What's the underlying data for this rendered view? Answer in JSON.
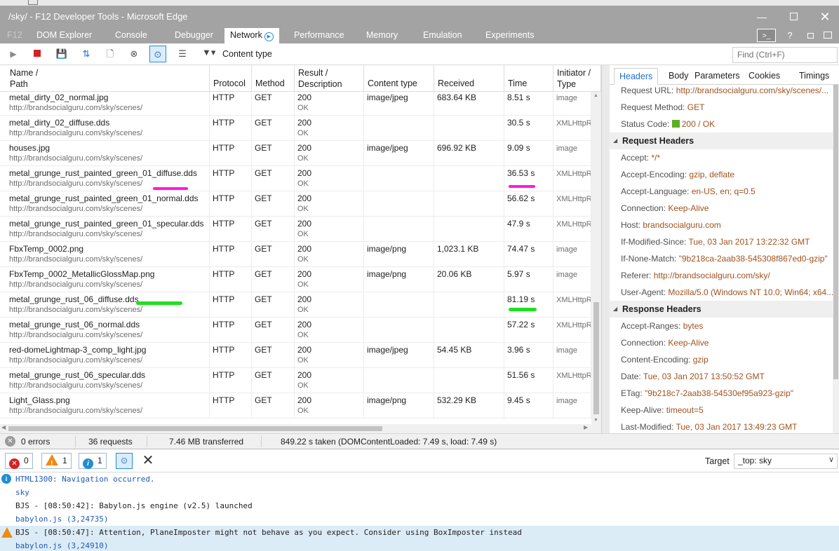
{
  "window": {
    "title": "/sky/ - F12 Developer Tools - Microsoft Edge",
    "min": "—",
    "close": "✕"
  },
  "tabs": [
    {
      "label": "F12"
    },
    {
      "label": "DOM Explorer"
    },
    {
      "label": "Console"
    },
    {
      "label": "Debugger"
    },
    {
      "label": "Network"
    },
    {
      "label": "Performance"
    },
    {
      "label": "Memory"
    },
    {
      "label": "Emulation"
    },
    {
      "label": "Experiments"
    }
  ],
  "toolbar": {
    "filter_label": "Content type",
    "find_placeholder": "Find (Ctrl+F)"
  },
  "columns": {
    "name_l1": "Name /",
    "name_l2": "Path",
    "protocol": "Protocol",
    "method": "Method",
    "result_l1": "Result /",
    "result_l2": "Description",
    "content_type": "Content type",
    "received": "Received",
    "time": "Time",
    "initiator_l1": "Initiator /",
    "initiator_l2": "Type"
  },
  "requests": [
    {
      "name": "metal_dirty_02_normal.jpg",
      "path": "http://brandsocialguru.com/sky/scenes/",
      "protocol": "HTTP",
      "method": "GET",
      "result": "200",
      "desc": "OK",
      "ctype": "image/jpeg",
      "received": "683.64 KB",
      "time": "8.51 s",
      "initiator": "image"
    },
    {
      "name": "metal_dirty_02_diffuse.dds",
      "path": "http://brandsocialguru.com/sky/scenes/",
      "protocol": "HTTP",
      "method": "GET",
      "result": "200",
      "desc": "OK",
      "ctype": "",
      "received": "",
      "time": "30.5 s",
      "initiator": "XMLHttpR"
    },
    {
      "name": "houses.jpg",
      "path": "http://brandsocialguru.com/sky/scenes/",
      "protocol": "HTTP",
      "method": "GET",
      "result": "200",
      "desc": "OK",
      "ctype": "image/jpeg",
      "received": "696.92 KB",
      "time": "9.09 s",
      "initiator": "image"
    },
    {
      "name": "metal_grunge_rust_painted_green_01_diffuse.dds",
      "path": "http://brandsocialguru.com/sky/scenes/",
      "protocol": "HTTP",
      "method": "GET",
      "result": "200",
      "desc": "OK",
      "ctype": "",
      "received": "",
      "time": "36.53 s",
      "initiator": "XMLHttpR"
    },
    {
      "name": "metal_grunge_rust_painted_green_01_normal.dds",
      "path": "http://brandsocialguru.com/sky/scenes/",
      "protocol": "HTTP",
      "method": "GET",
      "result": "200",
      "desc": "OK",
      "ctype": "",
      "received": "",
      "time": "56.62 s",
      "initiator": "XMLHttpR"
    },
    {
      "name": "metal_grunge_rust_painted_green_01_specular.dds",
      "path": "http://brandsocialguru.com/sky/scenes/",
      "protocol": "HTTP",
      "method": "GET",
      "result": "200",
      "desc": "OK",
      "ctype": "",
      "received": "",
      "time": "47.9 s",
      "initiator": "XMLHttpR"
    },
    {
      "name": "FbxTemp_0002.png",
      "path": "http://brandsocialguru.com/sky/scenes/",
      "protocol": "HTTP",
      "method": "GET",
      "result": "200",
      "desc": "OK",
      "ctype": "image/png",
      "received": "1,023.1 KB",
      "time": "74.47 s",
      "initiator": "image"
    },
    {
      "name": "FbxTemp_0002_MetallicGlossMap.png",
      "path": "http://brandsocialguru.com/sky/scenes/",
      "protocol": "HTTP",
      "method": "GET",
      "result": "200",
      "desc": "OK",
      "ctype": "image/png",
      "received": "20.06 KB",
      "time": "5.97 s",
      "initiator": "image"
    },
    {
      "name": "metal_grunge_rust_06_diffuse.dds",
      "path": "http://brandsocialguru.com/sky/scenes/",
      "protocol": "HTTP",
      "method": "GET",
      "result": "200",
      "desc": "OK",
      "ctype": "",
      "received": "",
      "time": "81.19 s",
      "initiator": "XMLHttpR"
    },
    {
      "name": "metal_grunge_rust_06_normal.dds",
      "path": "http://brandsocialguru.com/sky/scenes/",
      "protocol": "HTTP",
      "method": "GET",
      "result": "200",
      "desc": "OK",
      "ctype": "",
      "received": "",
      "time": "57.22 s",
      "initiator": "XMLHttpR"
    },
    {
      "name": "red-domeLightmap-3_comp_light.jpg",
      "path": "http://brandsocialguru.com/sky/scenes/",
      "protocol": "HTTP",
      "method": "GET",
      "result": "200",
      "desc": "OK",
      "ctype": "image/jpeg",
      "received": "54.45 KB",
      "time": "3.96 s",
      "initiator": "image"
    },
    {
      "name": "metal_grunge_rust_06_specular.dds",
      "path": "http://brandsocialguru.com/sky/scenes/",
      "protocol": "HTTP",
      "method": "GET",
      "result": "200",
      "desc": "OK",
      "ctype": "",
      "received": "",
      "time": "51.56 s",
      "initiator": "XMLHttpR"
    },
    {
      "name": "Light_Glass.png",
      "path": "http://brandsocialguru.com/sky/scenes/",
      "protocol": "HTTP",
      "method": "GET",
      "result": "200",
      "desc": "OK",
      "ctype": "image/png",
      "received": "532.29 KB",
      "time": "9.45 s",
      "initiator": "image"
    }
  ],
  "details": {
    "tabs": [
      "Headers",
      "Body",
      "Parameters",
      "Cookies",
      "Timings"
    ],
    "general": [
      {
        "k": "Request URL: ",
        "v": "http://brandsocialguru.com/sky/scenes/..."
      },
      {
        "k": "Request Method: ",
        "v": "GET"
      },
      {
        "k": "Status Code: ",
        "v": "200 / OK"
      }
    ],
    "request_headers_title": "Request Headers",
    "request_headers": [
      {
        "k": "Accept: ",
        "v": "*/*"
      },
      {
        "k": "Accept-Encoding: ",
        "v": "gzip, deflate"
      },
      {
        "k": "Accept-Language: ",
        "v": "en-US, en; q=0.5"
      },
      {
        "k": "Connection: ",
        "v": "Keep-Alive"
      },
      {
        "k": "Host: ",
        "v": "brandsocialguru.com"
      },
      {
        "k": "If-Modified-Since: ",
        "v": "Tue, 03 Jan 2017 13:22:32 GMT"
      },
      {
        "k": "If-None-Match: ",
        "v": "\"9b218ca-2aab38-545308f867ed0-gzip\""
      },
      {
        "k": "Referer: ",
        "v": "http://brandsocialguru.com/sky/"
      },
      {
        "k": "User-Agent: ",
        "v": "Mozilla/5.0 (Windows NT 10.0; Win64; x64..."
      }
    ],
    "response_headers_title": "Response Headers",
    "response_headers": [
      {
        "k": "Accept-Ranges: ",
        "v": "bytes"
      },
      {
        "k": "Connection: ",
        "v": "Keep-Alive"
      },
      {
        "k": "Content-Encoding: ",
        "v": "gzip"
      },
      {
        "k": "Date: ",
        "v": "Tue, 03 Jan 2017 13:50:52 GMT"
      },
      {
        "k": "ETag: ",
        "v": "\"9b218c7-2aab38-54530ef95a923-gzip\""
      },
      {
        "k": "Keep-Alive: ",
        "v": "timeout=5"
      },
      {
        "k": "Last-Modified: ",
        "v": "Tue, 03 Jan 2017 13:49:23 GMT"
      }
    ]
  },
  "status": {
    "errors": "0 errors",
    "requests": "36 requests",
    "transferred": "7.46 MB transferred",
    "taken": "849.22 s taken (DOMContentLoaded: 7.49 s, load: 7.49 s)"
  },
  "console": {
    "errors_count": "0",
    "warnings_count": "1",
    "info_count": "1",
    "target_label": "Target",
    "target_value": "_top: sky",
    "lines": [
      {
        "type": "info",
        "text": "HTML1300: Navigation occurred.",
        "link": false
      },
      {
        "type": "plain",
        "text": "sky",
        "link": true
      },
      {
        "type": "plain",
        "text": "BJS - [08:50:42]: Babylon.js engine (v2.5) launched",
        "link": false
      },
      {
        "type": "plain",
        "text": "babylon.js (3,24735)",
        "link": true
      },
      {
        "type": "warn",
        "text": "BJS - [08:50:47]: Attention, PlaneImposter might not behave as you expect. Consider using BoxImposter instead",
        "link": false
      },
      {
        "type": "warnlink",
        "text": "babylon.js (3,24910)",
        "link": true
      }
    ]
  },
  "colors": {
    "titlebar": "#a3a3a3",
    "accent": "#1e8fd0",
    "value_text": "#a0521d",
    "highlight_pink": "#ff1ad9",
    "highlight_green": "#20e020"
  }
}
